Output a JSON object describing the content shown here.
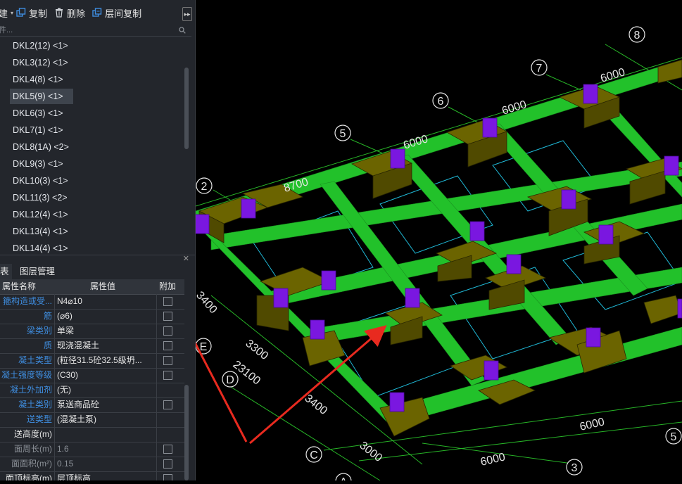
{
  "toolbar": {
    "partial_label": "建",
    "copy_label": "复制",
    "delete_label": "删除",
    "floor_copy_label": "层间复制",
    "expand_label": "▸▸"
  },
  "search": {
    "placeholder": "件..."
  },
  "component_list": [
    {
      "label": "DKL2(12)  <1>"
    },
    {
      "label": "DKL3(12)  <1>"
    },
    {
      "label": "DKL4(8)  <1>"
    },
    {
      "label": "DKL5(9)  <1>"
    },
    {
      "label": "DKL6(3)  <1>"
    },
    {
      "label": "DKL7(1)  <1>"
    },
    {
      "label": "DKL8(1A)  <2>"
    },
    {
      "label": "DKL9(3)  <1>"
    },
    {
      "label": "DKL10(3)  <1>"
    },
    {
      "label": "DKL11(3)  <2>"
    },
    {
      "label": "DKL12(4)  <1>"
    },
    {
      "label": "DKL13(4)  <1>"
    },
    {
      "label": "DKL14(4)  <1>"
    }
  ],
  "selected_index": 3,
  "tabs": [
    {
      "label": "表"
    },
    {
      "label": "图层管理"
    }
  ],
  "properties": {
    "header": {
      "name": "属性名称",
      "value": "属性值",
      "add": "附加"
    },
    "rows": [
      {
        "name": "箍构造或受...",
        "value": "N4⌀10",
        "check": true,
        "color": "blue"
      },
      {
        "name": "筋",
        "value": "(⌀6)",
        "check": true,
        "color": "blue"
      },
      {
        "name": "梁类别",
        "value": "单梁",
        "check": true,
        "color": "blue"
      },
      {
        "name": "质",
        "value": "现浇混凝土",
        "check": true,
        "color": "blue"
      },
      {
        "name": "凝土类型",
        "value": "(粒径31.5砼32.5级坍...",
        "check": true,
        "color": "blue"
      },
      {
        "name": "凝土强度等级",
        "value": "(C30)",
        "check": true,
        "color": "blue"
      },
      {
        "name": "凝土外加剂",
        "value": "(无)",
        "check": false,
        "color": "blue"
      },
      {
        "name": "凝土类别",
        "value": "泵送商品砼",
        "check": true,
        "color": "blue"
      },
      {
        "name": "送类型",
        "value": "(混凝土泵)",
        "check": false,
        "color": "blue"
      },
      {
        "name": "送高度(m)",
        "value": "",
        "check": false,
        "color": "white"
      },
      {
        "name": "面周长(m)",
        "value": "1.6",
        "check": true,
        "color": "blue",
        "dim": true
      },
      {
        "name": "面面积(m²)",
        "value": "0.15",
        "check": true,
        "color": "blue",
        "dim": true
      },
      {
        "name": "面顶标高(m)",
        "value": "层顶标高",
        "check": true,
        "color": "white"
      }
    ]
  },
  "cad": {
    "axis_labels": [
      "8",
      "7",
      "6",
      "5",
      "2",
      "E",
      "D",
      "C",
      "3",
      "5",
      "A"
    ],
    "dimensions": [
      "6000",
      "6000",
      "6000",
      "8700",
      "3400",
      "3300",
      "23100",
      "3400",
      "3000",
      "6000",
      "6000"
    ],
    "colors": {
      "beam": "#22c12a",
      "pad": "#6b6400",
      "column": "#7a17e0",
      "grid": "#27b427",
      "arrow": "#e82a1f"
    }
  }
}
